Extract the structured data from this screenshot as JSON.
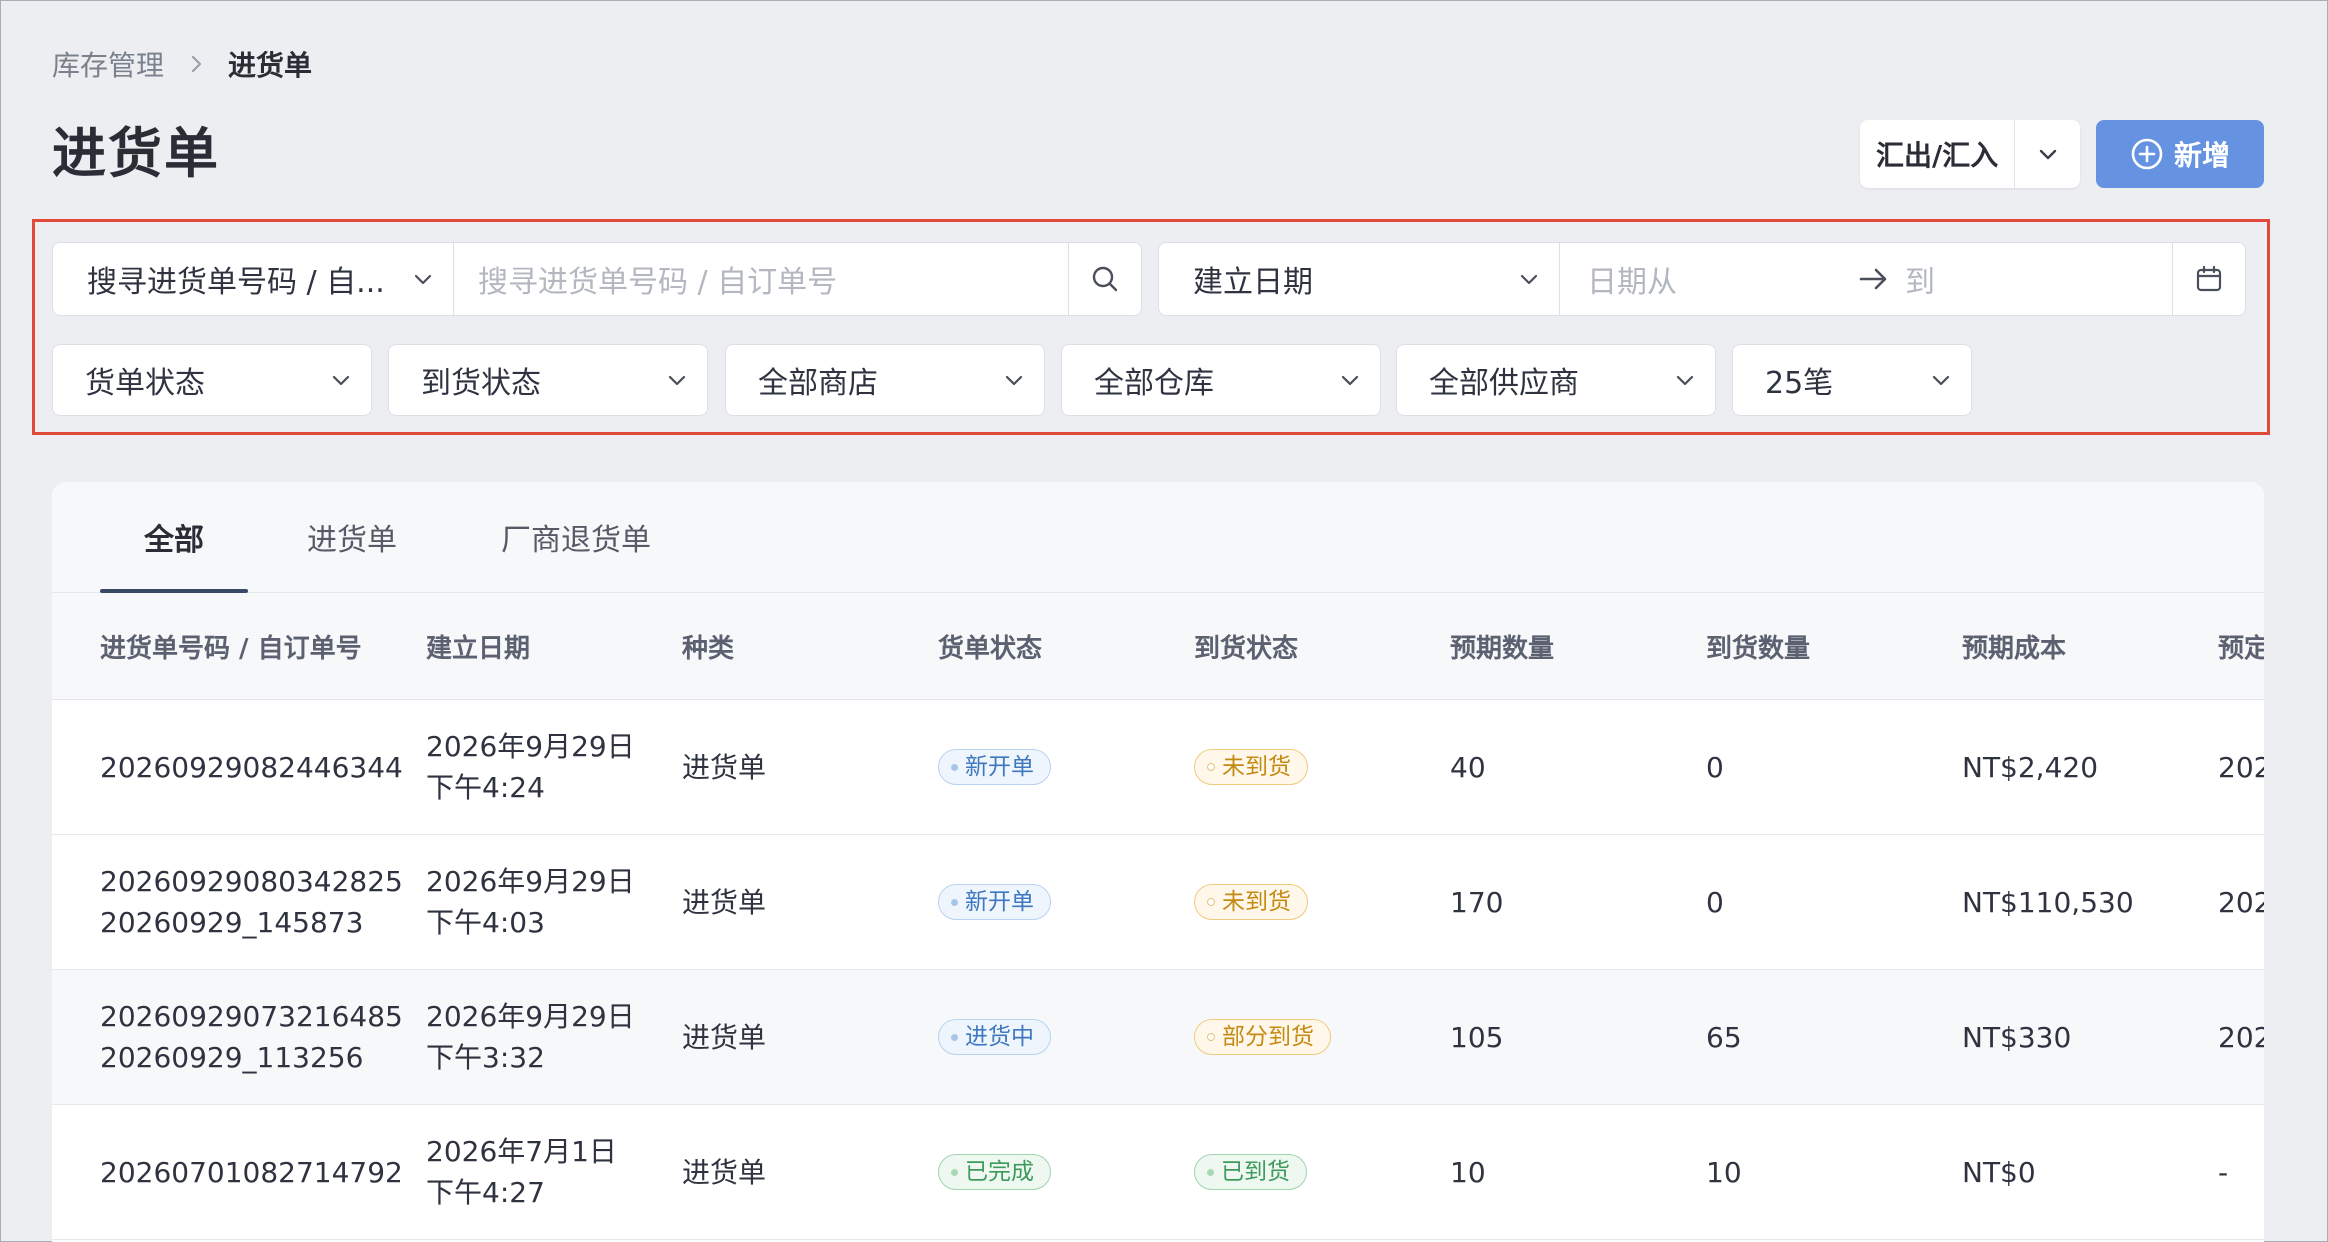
{
  "breadcrumb": {
    "parent": "库存管理",
    "current": "进货单"
  },
  "page": {
    "title": "进货单"
  },
  "header_actions": {
    "import_export_label": "汇出/汇入",
    "new_label": "新增"
  },
  "filters": {
    "search_field_select": "搜寻进货单号码 / 自...",
    "search_placeholder": "搜寻进货单号码 / 自订单号",
    "date_type_select": "建立日期",
    "date_from_placeholder": "日期从",
    "date_to_placeholder": "到",
    "dropdowns": [
      "货单状态",
      "到货状态",
      "全部商店",
      "全部仓库",
      "全部供应商",
      "25笔"
    ]
  },
  "tabs": [
    "全部",
    "进货单",
    "厂商退货单"
  ],
  "table": {
    "columns": [
      "进货单号码 / 自订单号",
      "建立日期",
      "种类",
      "货单状态",
      "到货状态",
      "预期数量",
      "到货数量",
      "预期成本",
      "预定"
    ],
    "rows": [
      {
        "order_no": "20260929082446344",
        "custom_no": "",
        "date": "2026年9月29日",
        "time": "下午4:24",
        "type": "进货单",
        "order_status": "新开单",
        "arrival_status": "未到货",
        "expected_qty": "40",
        "arrived_qty": "0",
        "expected_cost": "NT$2,420",
        "scheduled": "202"
      },
      {
        "order_no": "20260929080342825",
        "custom_no": "20260929_145873",
        "date": "2026年9月29日",
        "time": "下午4:03",
        "type": "进货单",
        "order_status": "新开单",
        "arrival_status": "未到货",
        "expected_qty": "170",
        "arrived_qty": "0",
        "expected_cost": "NT$110,530",
        "scheduled": "202"
      },
      {
        "order_no": "20260929073216485",
        "custom_no": "20260929_113256",
        "date": "2026年9月29日",
        "time": "下午3:32",
        "type": "进货单",
        "order_status": "进货中",
        "arrival_status": "部分到货",
        "expected_qty": "105",
        "arrived_qty": "65",
        "expected_cost": "NT$330",
        "scheduled": "202"
      },
      {
        "order_no": "20260701082714792",
        "custom_no": "",
        "date": "2026年7月1日",
        "time": "下午4:27",
        "type": "进货单",
        "order_status": "已完成",
        "arrival_status": "已到货",
        "expected_qty": "10",
        "arrived_qty": "10",
        "expected_cost": "NT$0",
        "scheduled": "-"
      }
    ]
  },
  "colors": {
    "primary_button": "#6593e2",
    "highlight_border": "#e04a3a",
    "page_bg": "#eceef1"
  }
}
